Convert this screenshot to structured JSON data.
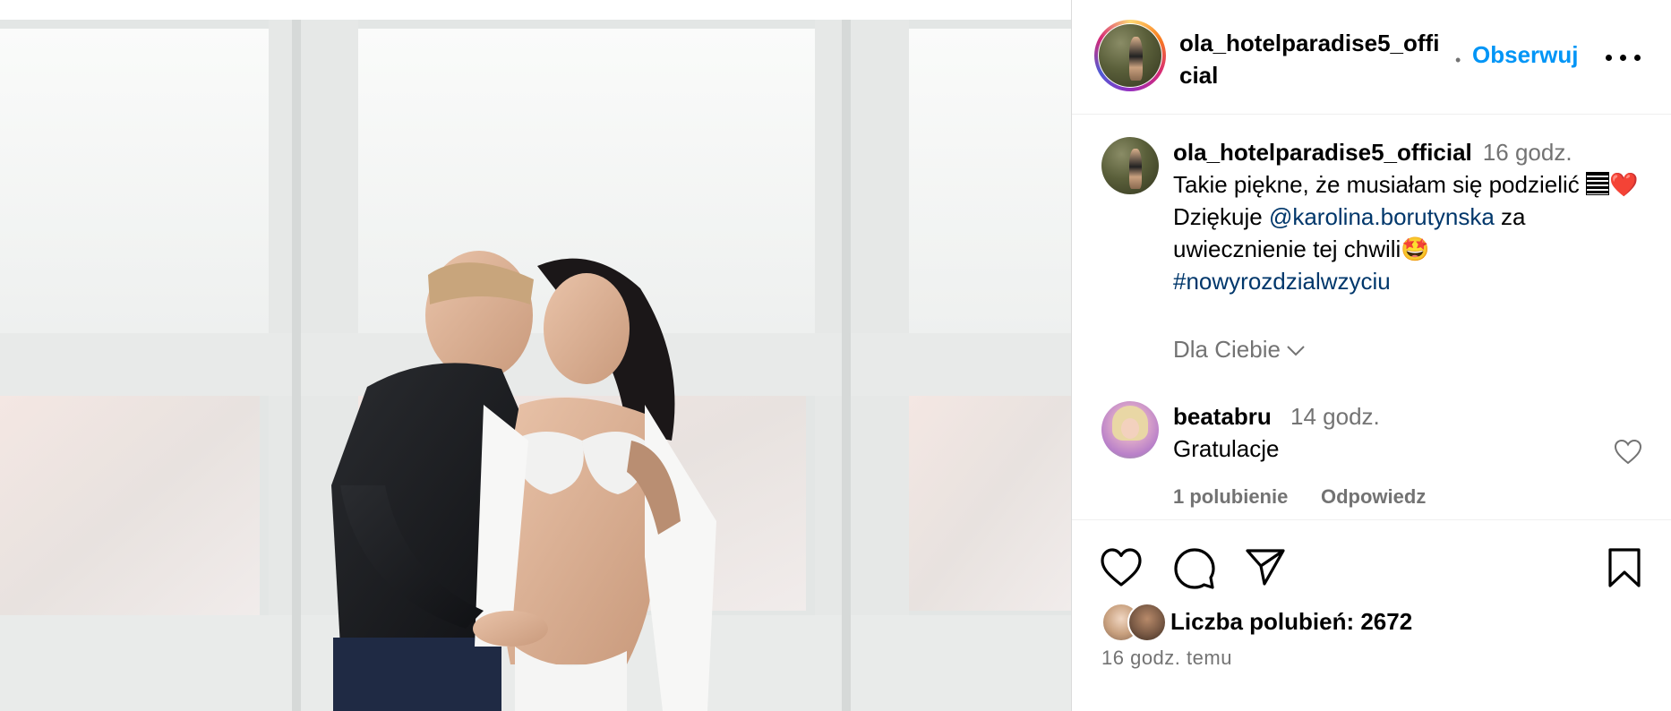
{
  "post": {
    "image_alt": "Zdjęcie ciążowe pary przy oknie"
  },
  "header": {
    "username": "ola_hotelparadise5_official",
    "separator": "•",
    "follow_label": "Obserwuj",
    "more_icon": "more-horizontal-icon"
  },
  "caption": {
    "username": "ola_hotelparadise5_official",
    "time": "16 godz.",
    "text_1": "Takie piękne, że musiałam się podzielić",
    "heart": "❤️",
    "text_2": " Dziękuje ",
    "mention": "@karolina.borutynska",
    "text_3": " za uwiecznienie tej chwili",
    "emoji": "🤩",
    "hashtag": "#nowyrozdzialwzyciu"
  },
  "dla_ciebie": "Dla Ciebie",
  "comment": {
    "username": "beatabru",
    "time": "14 godz.",
    "text": "Gratulacje",
    "likes": "1 polubienie",
    "reply": "Odpowiedz"
  },
  "actions": {
    "like_icon": "heart-outline-icon",
    "comment_icon": "comment-bubble-icon",
    "share_icon": "paper-plane-icon",
    "save_icon": "bookmark-outline-icon",
    "likes_label": "Liczba polubień: 2672",
    "post_time": "16 godz. temu"
  },
  "colors": {
    "link": "#0095f6",
    "mention": "#00376b",
    "muted": "#737373",
    "border": "#dbdbdb"
  }
}
